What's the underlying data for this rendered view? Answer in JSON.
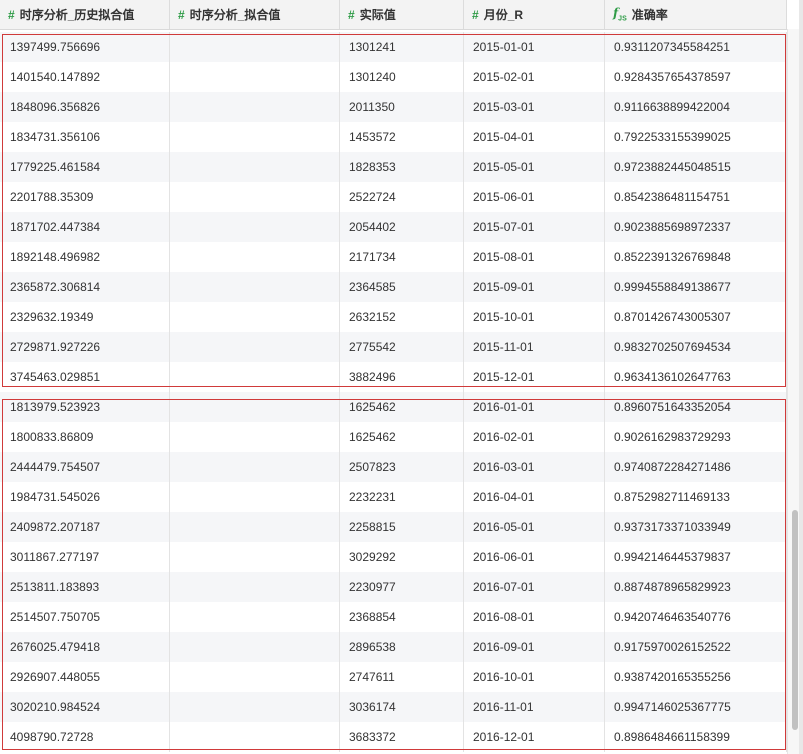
{
  "columns": [
    {
      "icon": "#",
      "label": "时序分析_历史拟合值"
    },
    {
      "icon": "#",
      "label": "时序分析_拟合值"
    },
    {
      "icon": "#",
      "label": "实际值"
    },
    {
      "icon": "#",
      "label": "月份_R"
    },
    {
      "icon": "fx",
      "label": "准确率"
    }
  ],
  "rows": [
    [
      "1397499.756696",
      "",
      "1301241",
      "2015-01-01",
      "0.9311207345584251"
    ],
    [
      "1401540.147892",
      "",
      "1301240",
      "2015-02-01",
      "0.9284357654378597"
    ],
    [
      "1848096.356826",
      "",
      "2011350",
      "2015-03-01",
      "0.9116638899422004"
    ],
    [
      "1834731.356106",
      "",
      "1453572",
      "2015-04-01",
      "0.7922533155399025"
    ],
    [
      "1779225.461584",
      "",
      "1828353",
      "2015-05-01",
      "0.9723882445048515"
    ],
    [
      "2201788.35309",
      "",
      "2522724",
      "2015-06-01",
      "0.8542386481154751"
    ],
    [
      "1871702.447384",
      "",
      "2054402",
      "2015-07-01",
      "0.9023885698972337"
    ],
    [
      "1892148.496982",
      "",
      "2171734",
      "2015-08-01",
      "0.8522391326769848"
    ],
    [
      "2365872.306814",
      "",
      "2364585",
      "2015-09-01",
      "0.9994558849138677"
    ],
    [
      "2329632.19349",
      "",
      "2632152",
      "2015-10-01",
      "0.8701426743005307"
    ],
    [
      "2729871.927226",
      "",
      "2775542",
      "2015-11-01",
      "0.9832702507694534"
    ],
    [
      "3745463.029851",
      "",
      "3882496",
      "2015-12-01",
      "0.9634136102647763"
    ],
    [
      "1813979.523923",
      "",
      "1625462",
      "2016-01-01",
      "0.8960751643352054"
    ],
    [
      "1800833.86809",
      "",
      "1625462",
      "2016-02-01",
      "0.9026162983729293"
    ],
    [
      "2444479.754507",
      "",
      "2507823",
      "2016-03-01",
      "0.9740872284271486"
    ],
    [
      "1984731.545026",
      "",
      "2232231",
      "2016-04-01",
      "0.8752982711469133"
    ],
    [
      "2409872.207187",
      "",
      "2258815",
      "2016-05-01",
      "0.9373173371033949"
    ],
    [
      "3011867.277197",
      "",
      "3029292",
      "2016-06-01",
      "0.9942146445379837"
    ],
    [
      "2513811.183893",
      "",
      "2230977",
      "2016-07-01",
      "0.8874878965829923"
    ],
    [
      "2514507.750705",
      "",
      "2368854",
      "2016-08-01",
      "0.9420746463540776"
    ],
    [
      "2676025.479418",
      "",
      "2896538",
      "2016-09-01",
      "0.9175970026152522"
    ],
    [
      "2926907.448055",
      "",
      "2747611",
      "2016-10-01",
      "0.9387420165355256"
    ],
    [
      "3020210.984524",
      "",
      "3036174",
      "2016-11-01",
      "0.9947146025367775"
    ],
    [
      "4098790.72728",
      "",
      "3683372",
      "2016-12-01",
      "0.8986484661158399"
    ]
  ],
  "colors": {
    "numeric_icon": "#2e9b46",
    "highlight_box": "#d03a3a",
    "alt_row": "#f5f6f8"
  }
}
